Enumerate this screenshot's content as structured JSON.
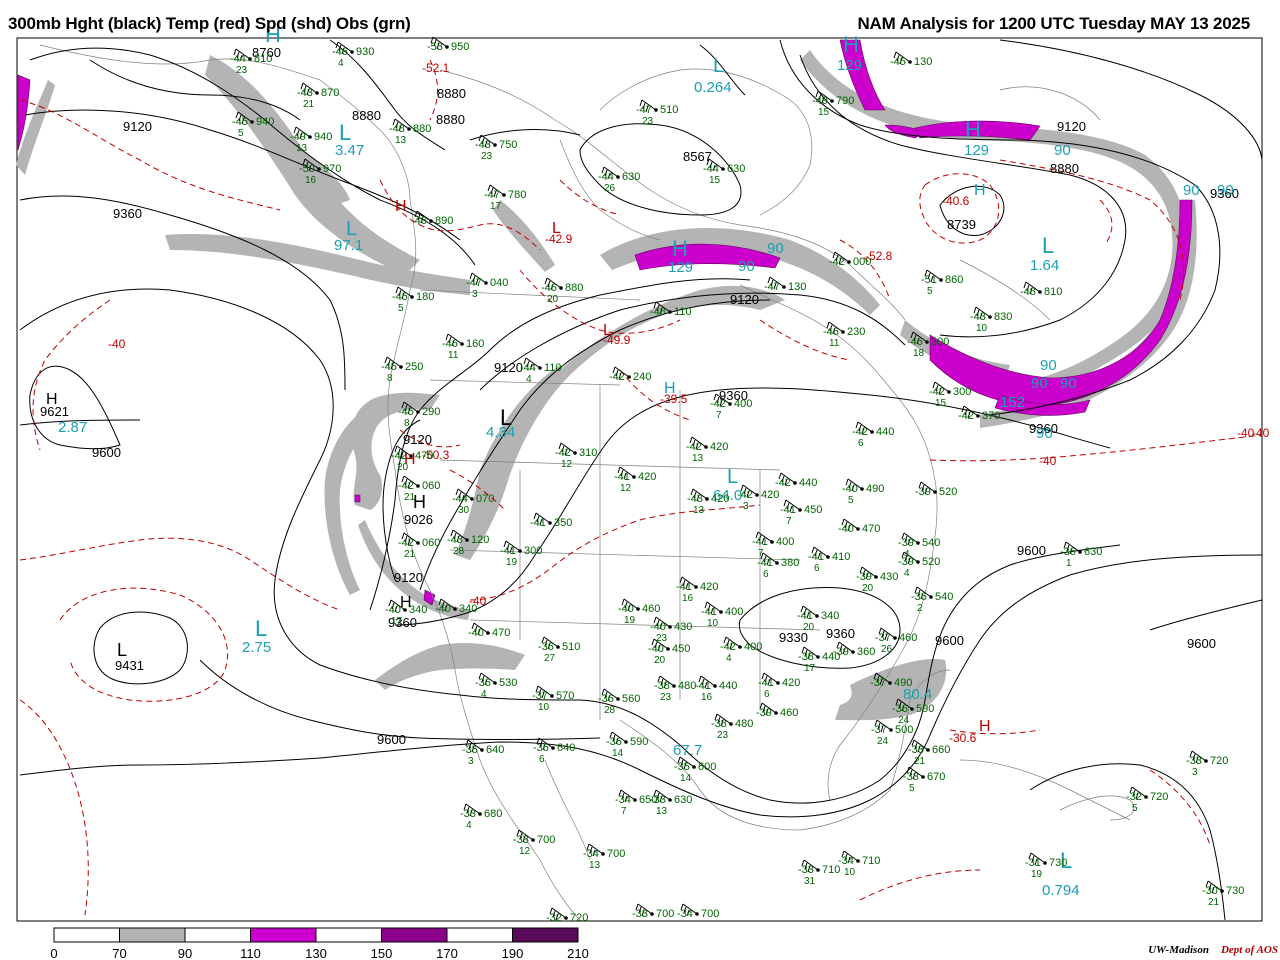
{
  "header": {
    "left_title": "300mb Hght (black) Temp (red) Spd (shd) Obs (grn)",
    "right_title": "NAM Analysis for 1200 UTC Tuesday  MAY 13 2025"
  },
  "credit": {
    "org": "UW-Madison",
    "dept": "Dept of AOS"
  },
  "colors": {
    "height_contour": "#000000",
    "temp_contour": "#c00000",
    "speed_70_90": "#b4b4b4",
    "speed_90_110": "#ffffff",
    "speed_110_130": "#cc00cc",
    "speed_130_150": "#ffffff",
    "speed_150_170": "#8a008a",
    "speed_190_210": "#5a0a5a",
    "obs": "#006400",
    "speed_labels": "#1aa0b4",
    "geography": "#808080"
  },
  "legend": {
    "ticks": [
      "0",
      "70",
      "90",
      "110",
      "130",
      "150",
      "170",
      "190",
      "210"
    ],
    "fills": [
      "#ffffff",
      "#b4b4b4",
      "#ffffff",
      "#cc00cc",
      "#ffffff",
      "#8a008a",
      "#ffffff",
      "#5a0a5a"
    ]
  },
  "height_labels": [
    {
      "t": "8760"
    },
    {
      "t": "8880"
    },
    {
      "t": "8880"
    },
    {
      "t": "8880"
    },
    {
      "t": "9120"
    },
    {
      "t": "9360"
    },
    {
      "t": "8567"
    },
    {
      "t": "9120"
    },
    {
      "t": "8880"
    },
    {
      "t": "8739"
    },
    {
      "t": "9360"
    },
    {
      "t": "9120"
    },
    {
      "t": "9120"
    },
    {
      "t": "9360"
    },
    {
      "t": "9360"
    },
    {
      "t": "9621"
    },
    {
      "t": "9600"
    },
    {
      "t": "9120"
    },
    {
      "t": "9026"
    },
    {
      "t": "9120"
    },
    {
      "t": "9360"
    },
    {
      "t": "9431"
    },
    {
      "t": "9600"
    },
    {
      "t": "9600"
    },
    {
      "t": "9330"
    },
    {
      "t": "9360"
    },
    {
      "t": "9600"
    },
    {
      "t": "9600"
    }
  ],
  "temp_labels": [
    {
      "t": "-40"
    },
    {
      "t": "-52.1"
    },
    {
      "t": "-42.9"
    },
    {
      "t": "-49.9"
    },
    {
      "t": "-39.5"
    },
    {
      "t": "-50.3"
    },
    {
      "t": "-40"
    },
    {
      "t": "-40.6"
    },
    {
      "t": "-52.8"
    },
    {
      "t": "-40"
    },
    {
      "t": "-40"
    },
    {
      "t": "-30.6"
    },
    {
      "t": "-40"
    }
  ],
  "speed_labels": [
    {
      "t": "0.264"
    },
    {
      "t": "129"
    },
    {
      "t": "97.1"
    },
    {
      "t": "4.34"
    },
    {
      "t": "2.87"
    },
    {
      "t": "2.75"
    },
    {
      "t": "129"
    },
    {
      "t": "90"
    },
    {
      "t": "90"
    },
    {
      "t": "1.64"
    },
    {
      "t": "129"
    },
    {
      "t": "90"
    },
    {
      "t": "90"
    },
    {
      "t": "90"
    },
    {
      "t": "90"
    },
    {
      "t": "90"
    },
    {
      "t": "152"
    },
    {
      "t": "90"
    },
    {
      "t": "67.7"
    },
    {
      "t": "80.4"
    },
    {
      "t": "0.794"
    },
    {
      "t": "3.47"
    },
    {
      "t": "90"
    },
    {
      "t": "64.0"
    }
  ],
  "pressure_centers": [
    {
      "t": "H"
    },
    {
      "t": "L"
    },
    {
      "t": "H"
    },
    {
      "t": "H"
    },
    {
      "t": "L"
    },
    {
      "t": "H"
    },
    {
      "t": "L"
    },
    {
      "t": "H"
    },
    {
      "t": "L"
    },
    {
      "t": "H"
    },
    {
      "t": "H"
    },
    {
      "t": "L"
    },
    {
      "t": "L"
    },
    {
      "t": "H"
    },
    {
      "t": "L"
    },
    {
      "t": "H"
    },
    {
      "t": "H"
    },
    {
      "t": "H"
    },
    {
      "t": "L"
    },
    {
      "t": "L"
    },
    {
      "t": "L"
    },
    {
      "t": "H"
    },
    {
      "t": "L"
    }
  ],
  "observations": [
    {
      "t": "-44",
      "v": "810",
      "d": "23"
    },
    {
      "t": "-46",
      "v": "930",
      "d": "4"
    },
    {
      "t": "-53",
      "v": "950",
      "d": ""
    },
    {
      "t": "-43",
      "v": "870",
      "d": "21"
    },
    {
      "t": "-45",
      "v": "940",
      "d": "5"
    },
    {
      "t": "-49",
      "v": "940",
      "d": "13"
    },
    {
      "t": "-48",
      "v": "880",
      "d": "13"
    },
    {
      "t": "-50",
      "v": "970",
      "d": "16"
    },
    {
      "t": "-43",
      "v": "750",
      "d": "23"
    },
    {
      "t": "-47",
      "v": "510",
      "d": "23"
    },
    {
      "t": "-49",
      "v": "790",
      "d": "15"
    },
    {
      "t": "-44",
      "v": "630",
      "d": "26"
    },
    {
      "t": "-44",
      "v": "630",
      "d": "15"
    },
    {
      "t": "-47",
      "v": "780",
      "d": "17"
    },
    {
      "t": "-46",
      "v": "890",
      "d": ""
    },
    {
      "t": "-47",
      "v": "040",
      "d": "3"
    },
    {
      "t": "-46",
      "v": "880",
      "d": "20"
    },
    {
      "t": "-45",
      "v": "180",
      "d": "5"
    },
    {
      "t": "-46",
      "v": "160",
      "d": "11"
    },
    {
      "t": "-45",
      "v": "250",
      "d": "8"
    },
    {
      "t": "-45",
      "v": "290",
      "d": "8"
    },
    {
      "t": "-48",
      "v": "110",
      "d": ""
    },
    {
      "t": "-47",
      "v": "130",
      "d": ""
    },
    {
      "t": "-42",
      "v": "000",
      "d": ""
    },
    {
      "t": "-51",
      "v": "860",
      "d": "5"
    },
    {
      "t": "-48",
      "v": "810",
      "d": ""
    },
    {
      "t": "-43",
      "v": "830",
      "d": "10"
    },
    {
      "t": "-46",
      "v": "230",
      "d": "11"
    },
    {
      "t": "-46",
      "v": "300",
      "d": "18"
    },
    {
      "t": "-42",
      "v": "300",
      "d": "15"
    },
    {
      "t": "-42",
      "v": "370",
      "d": ""
    },
    {
      "t": "-42",
      "v": "440",
      "d": "6"
    },
    {
      "t": "-42",
      "v": "240",
      "d": ""
    },
    {
      "t": "-42",
      "v": "400",
      "d": "7"
    },
    {
      "t": "-44",
      "v": "110",
      "d": "4"
    },
    {
      "t": "-42",
      "v": "420",
      "d": "13"
    },
    {
      "t": "-42",
      "v": "310",
      "d": "12"
    },
    {
      "t": "-41",
      "v": "420",
      "d": "12"
    },
    {
      "t": "-42",
      "v": "470",
      "d": "20"
    },
    {
      "t": "-44",
      "v": "070",
      "d": "30"
    },
    {
      "t": "-42",
      "v": "060",
      "d": "21"
    },
    {
      "t": "-43",
      "v": "120",
      "d": "28"
    },
    {
      "t": "-41",
      "v": "300",
      "d": "19"
    },
    {
      "t": "-41",
      "v": "350",
      "d": ""
    },
    {
      "t": "-43",
      "v": "420",
      "d": "13"
    },
    {
      "t": "-42",
      "v": "420",
      "d": "3"
    },
    {
      "t": "-42",
      "v": "440",
      "d": ""
    },
    {
      "t": "-41",
      "v": "450",
      "d": "7"
    },
    {
      "t": "-40",
      "v": "490",
      "d": "5"
    },
    {
      "t": "-39",
      "v": "520",
      "d": ""
    },
    {
      "t": "-40",
      "v": "470",
      "d": ""
    },
    {
      "t": "-39",
      "v": "540",
      "d": "4"
    },
    {
      "t": "-41",
      "v": "400",
      "d": "7"
    },
    {
      "t": "-41",
      "v": "380",
      "d": "6"
    },
    {
      "t": "-41",
      "v": "410",
      "d": "6"
    },
    {
      "t": "-39",
      "v": "430",
      "d": "20"
    },
    {
      "t": "-39",
      "v": "520",
      "d": "4"
    },
    {
      "t": "-41",
      "v": "420",
      "d": "16"
    },
    {
      "t": "-40",
      "v": "460",
      "d": "19"
    },
    {
      "t": "-41",
      "v": "400",
      "d": "10"
    },
    {
      "t": "-40",
      "v": "430",
      "d": "23"
    },
    {
      "t": "-40",
      "v": "450",
      "d": "20"
    },
    {
      "t": "-42",
      "v": "400",
      "d": "4"
    },
    {
      "t": "-41",
      "v": "340",
      "d": "20"
    },
    {
      "t": "-39",
      "v": "360",
      "d": ""
    },
    {
      "t": "-38",
      "v": "440",
      "d": "17"
    },
    {
      "t": "-36",
      "v": "540",
      "d": "2"
    },
    {
      "t": "-37",
      "v": "460",
      "d": "26"
    },
    {
      "t": "-40",
      "v": "340",
      "d": "17"
    },
    {
      "t": "-40",
      "v": "470",
      "d": ""
    },
    {
      "t": "-36",
      "v": "510",
      "d": "27"
    },
    {
      "t": "-36",
      "v": "530",
      "d": "4"
    },
    {
      "t": "-37",
      "v": "570",
      "d": "10"
    },
    {
      "t": "-36",
      "v": "560",
      "d": "28"
    },
    {
      "t": "-38",
      "v": "480",
      "d": "23"
    },
    {
      "t": "-41",
      "v": "440",
      "d": "16"
    },
    {
      "t": "-41",
      "v": "420",
      "d": "6"
    },
    {
      "t": "-37",
      "v": "490",
      "d": ""
    },
    {
      "t": "-36",
      "v": "590",
      "d": "24"
    },
    {
      "t": "-37",
      "v": "500",
      "d": "24"
    },
    {
      "t": "-39",
      "v": "460",
      "d": ""
    },
    {
      "t": "-38",
      "v": "480",
      "d": "23"
    },
    {
      "t": "-35",
      "v": "640",
      "d": "3"
    },
    {
      "t": "-36",
      "v": "640",
      "d": "6"
    },
    {
      "t": "-36",
      "v": "590",
      "d": "14"
    },
    {
      "t": "-35",
      "v": "600",
      "d": "14"
    },
    {
      "t": "-33",
      "v": "660",
      "d": "21"
    },
    {
      "t": "-33",
      "v": "670",
      "d": "5"
    },
    {
      "t": "-34",
      "v": "650",
      "d": "7"
    },
    {
      "t": "-33",
      "v": "630",
      "d": "13"
    },
    {
      "t": "-33",
      "v": "680",
      "d": "4"
    },
    {
      "t": "-33",
      "v": "700",
      "d": "12"
    },
    {
      "t": "-34",
      "v": "700",
      "d": "13"
    },
    {
      "t": "-33",
      "v": "710",
      "d": "31"
    },
    {
      "t": "-34",
      "v": "710",
      "d": "10"
    },
    {
      "t": "-31",
      "v": "730",
      "d": "19"
    },
    {
      "t": "-33",
      "v": "720",
      "d": "3"
    },
    {
      "t": "-32",
      "v": "720",
      "d": "5"
    },
    {
      "t": "-30",
      "v": "730",
      "d": "21"
    },
    {
      "t": "-32",
      "v": "720",
      "d": ""
    },
    {
      "t": "-33",
      "v": "700",
      "d": ""
    },
    {
      "t": "-34",
      "v": "700",
      "d": ""
    },
    {
      "t": "-36",
      "v": "630",
      "d": "1"
    },
    {
      "t": "-42",
      "v": "060",
      "d": "21"
    },
    {
      "t": "-45",
      "v": "130",
      "d": ""
    },
    {
      "t": "-40",
      "v": "340",
      "d": ""
    }
  ]
}
